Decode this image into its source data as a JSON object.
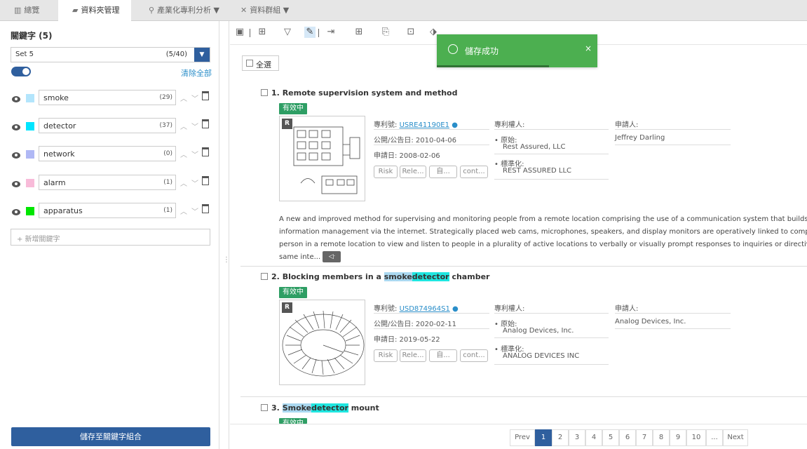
{
  "tabs": [
    {
      "icon": "chart-icon",
      "label": "總覽"
    },
    {
      "icon": "folder-icon",
      "label": "資料夾管理"
    },
    {
      "icon": "search-chart-icon",
      "label": "產業化專利分析 ▼"
    },
    {
      "icon": "cluster-icon",
      "label": "資料群組 ▼"
    }
  ],
  "sidebar": {
    "title": "關鍵字 (5)",
    "set_name": "Set 5",
    "set_count": "(5/40)",
    "clear_all": "清除全部",
    "keywords": [
      {
        "term": "smoke",
        "count": "(29)",
        "color": "#b3e5fc"
      },
      {
        "term": "detector",
        "count": "(37)",
        "color": "#00e5ff"
      },
      {
        "term": "network",
        "count": "(0)",
        "color": "#b0b8f5"
      },
      {
        "term": "alarm",
        "count": "(1)",
        "color": "#f8bbd9"
      },
      {
        "term": "apparatus",
        "count": "(1)",
        "color": "#00e600"
      }
    ],
    "new_keyword_placeholder": "+ 新增關鍵字",
    "save_button": "儲存至關鍵字組合"
  },
  "toast": {
    "message": "儲存成功",
    "close": "×"
  },
  "select_all": "全選",
  "results": [
    {
      "index": "1.",
      "title": "Remote supervision system and method",
      "status": "有效中",
      "patent_no_label": "專利號:",
      "patent_no": "USRE41190E1",
      "pub_label": "公開/公告日: 2010-04-06",
      "app_label": "申請日: 2008-02-06",
      "assignee_label": "專利權人:",
      "orig_label": "• 原始:",
      "orig_value": "Rest Assured, LLC",
      "std_label": "• 標準化:",
      "std_value": "REST ASSURED LLC",
      "applicant_label": "申請人:",
      "applicant_value": "Jeffrey Darling",
      "tags": [
        "Risk",
        "Rele...",
        "自...",
        "cont..."
      ],
      "abstract": [
        "A new and improved method for supervising and monitoring people from a remote location comprising the use of a communication system that builds upon tel",
        "information management via the internet. Strategically placed web cams, microphones, speakers, and display monitors are operatively linked to computers and i",
        "person in a remote location to view and listen to people in a plurality of active locations to verbally or visually prompt responses to inquiries or directives. The pe",
        "same inte..."
      ]
    },
    {
      "index": "2.",
      "title_pre": "Blocking members in a ",
      "title_hl1": "smoke",
      "title_hl2": "detector",
      "title_post": " chamber",
      "status": "有效中",
      "patent_no_label": "專利號:",
      "patent_no": "USD874964S1",
      "pub_label": "公開/公告日: 2020-02-11",
      "app_label": "申請日: 2019-05-22",
      "assignee_label": "專利權人:",
      "orig_label": "• 原始:",
      "orig_value": "Analog Devices, Inc.",
      "std_label": "• 標準化:",
      "std_value": "ANALOG DEVICES INC",
      "applicant_label": "申請人:",
      "applicant_value": "Analog Devices, Inc.",
      "tags": [
        "Risk",
        "Rele...",
        "自...",
        "cont..."
      ]
    },
    {
      "index": "3.",
      "title_hl1": "Smoke",
      "title_hl2": "detector",
      "title_post": " mount",
      "status": "有效中"
    }
  ],
  "pagination": {
    "prev": "Prev",
    "pages": [
      "1",
      "2",
      "3",
      "4",
      "5",
      "6",
      "7",
      "8",
      "9",
      "10",
      "..."
    ],
    "next": "Next",
    "current": "1"
  }
}
